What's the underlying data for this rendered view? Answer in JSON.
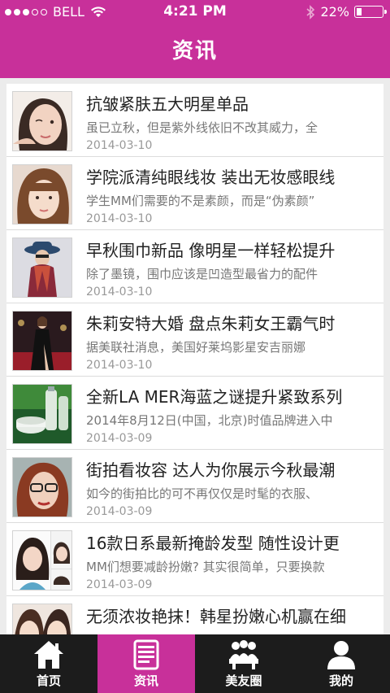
{
  "status": {
    "carrier": "BELL",
    "time": "4:21 PM",
    "battery": "22%",
    "battery_level": 0.22
  },
  "header": {
    "title": "资讯"
  },
  "news": [
    {
      "title": "抗皱紧肤五大明星单品",
      "summary": "虽已立秋，但是紫外线依旧不改其威力，全",
      "date": "2014-03-10",
      "thumb": "woman-face-wink"
    },
    {
      "title": "学院派清纯眼线妆 装出无妆感眼线",
      "summary": "学生MM们需要的不是素颜，而是“伪素颜”",
      "date": "2014-03-10",
      "thumb": "woman-bangs-portrait"
    },
    {
      "title": "早秋围巾新品 像明星一样轻松提升",
      "summary": "除了墨镜，围巾应该是凹造型最省力的配件",
      "date": "2014-03-10",
      "thumb": "woman-hat-scarf"
    },
    {
      "title": "朱莉安特大婚 盘点朱莉女王霸气时",
      "summary": "据美联社消息，美国好莱坞影星安吉丽娜",
      "date": "2014-03-10",
      "thumb": "woman-black-gown"
    },
    {
      "title": "全新LA MER海蓝之谜提升紧致系列",
      "summary": "2014年8月12日(中国，北京)时值品牌进入中",
      "date": "2014-03-09",
      "thumb": "skincare-bottles"
    },
    {
      "title": "街拍看妆容  达人为你展示今秋最潮",
      "summary": "如今的街拍比的可不再仅仅是时髦的衣服、",
      "date": "2014-03-09",
      "thumb": "woman-glasses"
    },
    {
      "title": "16款日系最新掩龄发型 随性设计更",
      "summary": "MM们想要减龄扮嫩? 其实很简单，只要换款",
      "date": "2014-03-09",
      "thumb": "hairstyles-collage"
    },
    {
      "title": "无须浓妆艳抹！韩星扮嫩心机赢在细",
      "summary": "",
      "date": "",
      "thumb": "korean-stars"
    }
  ],
  "tabs": [
    {
      "label": "首页",
      "icon": "home-icon"
    },
    {
      "label": "资讯",
      "icon": "news-book-icon"
    },
    {
      "label": "美友圈",
      "icon": "friends-group-icon"
    },
    {
      "label": "我的",
      "icon": "user-icon"
    }
  ],
  "colors": {
    "brand": "#c8309a",
    "tabbar": "#1c1c1c"
  }
}
